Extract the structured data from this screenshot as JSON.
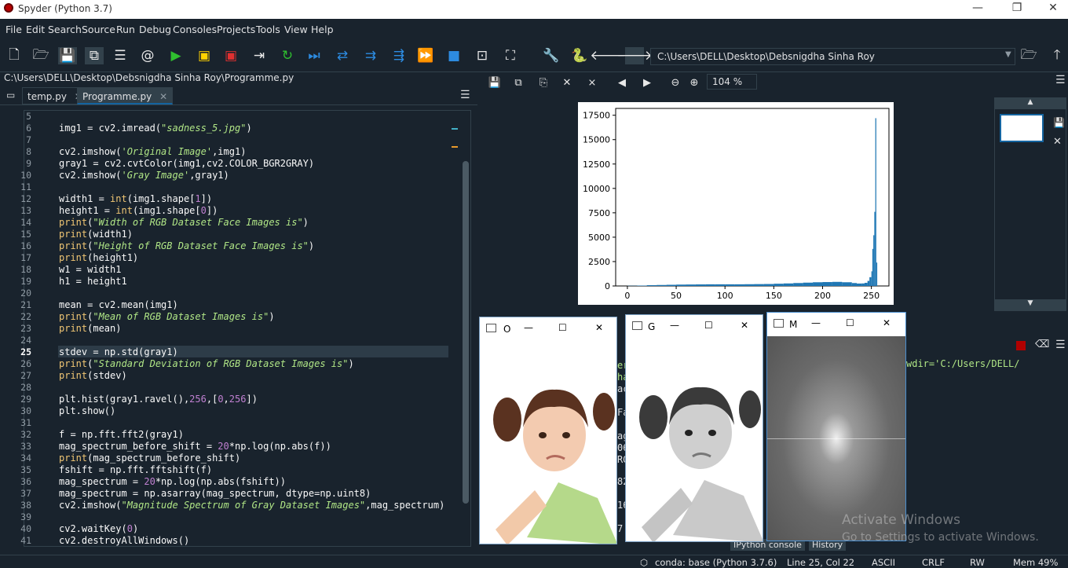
{
  "window": {
    "title": "Spyder (Python 3.7)",
    "minimize": "—",
    "restore": "❐",
    "close": "✕"
  },
  "menu": [
    "File",
    "Edit",
    "Search",
    "Source",
    "Run",
    "Debug",
    "Consoles",
    "Projects",
    "Tools",
    "View",
    "Help"
  ],
  "toolbar": {
    "working_dir": "C:\\Users\\DELL\\Desktop\\Debsnigdha Sinha Roy"
  },
  "editor": {
    "file_path": "C:\\Users\\DELL\\Desktop\\Debsnigdha Sinha Roy\\Programme.py",
    "tabs": [
      {
        "label": "temp.py",
        "active": false
      },
      {
        "label": "Programme.py",
        "active": true
      }
    ],
    "current_line": "25",
    "lines": [
      {
        "n": "5",
        "html": ""
      },
      {
        "n": "6",
        "html": "img1 = cv2.imread(<span class='str'>\"<i>sadness_5.jpg</i>\"</span>)"
      },
      {
        "n": "7",
        "html": ""
      },
      {
        "n": "8",
        "html": "cv2.imshow(<span class='str'><i>'Original Image'</i></span>,img1)"
      },
      {
        "n": "9",
        "html": "gray1 = cv2.cvtColor(img1,cv2.COLOR_BGR2GRAY)"
      },
      {
        "n": "10",
        "html": "cv2.imshow(<span class='str'><i>'Gray Image'</i></span>,gray1)"
      },
      {
        "n": "11",
        "html": ""
      },
      {
        "n": "12",
        "html": "width1 = <span class='kw'>int</span>(img1.shape[<span class='num'>1</span>])"
      },
      {
        "n": "13",
        "html": "height1 = <span class='kw'>int</span>(img1.shape[<span class='num'>0</span>])"
      },
      {
        "n": "14",
        "html": "<span class='kw'>print</span>(<span class='str'><i>\"Width of RGB Dataset Face Images is\"</i></span>)"
      },
      {
        "n": "15",
        "html": "<span class='kw'>print</span>(width1)"
      },
      {
        "n": "16",
        "html": "<span class='kw'>print</span>(<span class='str'><i>\"Height of RGB Dataset Face Images is\"</i></span>)"
      },
      {
        "n": "17",
        "html": "<span class='kw'>print</span>(height1)"
      },
      {
        "n": "18",
        "html": "w1 = width1"
      },
      {
        "n": "19",
        "html": "h1 = height1"
      },
      {
        "n": "20",
        "html": ""
      },
      {
        "n": "21",
        "html": "mean = cv2.mean(img1)"
      },
      {
        "n": "22",
        "html": "<span class='kw'>print</span>(<span class='str'><i>\"Mean of RGB Dataset Images is\"</i></span>)"
      },
      {
        "n": "23",
        "html": "<span class='kw'>print</span>(mean)"
      },
      {
        "n": "24",
        "html": ""
      },
      {
        "n": "25",
        "html": "stdev = np.std(gray1)"
      },
      {
        "n": "26",
        "html": "<span class='kw'>print</span>(<span class='str'><i>\"Standard Deviation of RGB Dataset Images is\"</i></span>)"
      },
      {
        "n": "27",
        "html": "<span class='kw'>print</span>(stdev)"
      },
      {
        "n": "28",
        "html": ""
      },
      {
        "n": "29",
        "html": "plt.hist(gray1.ravel(),<span class='num'>256</span>,[<span class='num'>0</span>,<span class='num'>256</span>])"
      },
      {
        "n": "30",
        "html": "plt.show()"
      },
      {
        "n": "31",
        "html": ""
      },
      {
        "n": "32",
        "html": "f = np.fft.fft2(gray1)"
      },
      {
        "n": "33",
        "html": "mag_spectrum_before_shift = <span class='num'>20</span>*np.log(np.abs(f))"
      },
      {
        "n": "34",
        "html": "<span class='kw'>print</span>(mag_spectrum_before_shift)"
      },
      {
        "n": "35",
        "html": "fshift = np.fft.fftshift(f)"
      },
      {
        "n": "36",
        "html": "mag_spectrum = <span class='num'>20</span>*np.log(np.abs(fshift))"
      },
      {
        "n": "37",
        "html": "mag_spectrum = np.asarray(mag_spectrum, dtype=np.uint8)"
      },
      {
        "n": "38",
        "html": "cv2.imshow(<span class='str'><i>\"Magnitude Spectrum of Gray Dataset Images\"</i></span>,mag_spectrum)"
      },
      {
        "n": "39",
        "html": ""
      },
      {
        "n": "40",
        "html": "cv2.waitKey(<span class='num'>0</span>)"
      },
      {
        "n": "41",
        "html": "cv2.destroyAllWindows()"
      }
    ]
  },
  "plots": {
    "zoom": "104 %"
  },
  "chart_data": {
    "type": "bar",
    "title": "",
    "xlabel": "",
    "ylabel": "",
    "xlim": [
      -12,
      268
    ],
    "ylim": [
      0,
      18200
    ],
    "xticks": [
      0,
      50,
      100,
      150,
      200,
      250
    ],
    "yticks": [
      0,
      2500,
      5000,
      7500,
      10000,
      12500,
      15000,
      17500
    ],
    "bins_x": [
      0,
      10,
      20,
      30,
      40,
      50,
      60,
      70,
      80,
      90,
      100,
      110,
      120,
      130,
      140,
      150,
      160,
      170,
      180,
      190,
      200,
      210,
      220,
      230,
      235,
      240,
      243,
      246,
      248,
      250,
      251,
      252,
      253,
      254,
      255
    ],
    "values": [
      20,
      40,
      80,
      100,
      120,
      140,
      150,
      160,
      170,
      170,
      170,
      170,
      180,
      190,
      200,
      230,
      260,
      300,
      340,
      380,
      400,
      420,
      380,
      300,
      250,
      260,
      320,
      520,
      900,
      1500,
      3800,
      5200,
      7600,
      17200,
      2400
    ],
    "grid": false,
    "color": "#1f77b4"
  },
  "cv_windows": [
    {
      "title": "O",
      "min": "—",
      "max": "☐",
      "close": "✕"
    },
    {
      "title": "G",
      "min": "—",
      "max": "☐",
      "close": "✕"
    },
    {
      "title": "M",
      "min": "—",
      "max": "☐",
      "close": "✕"
    }
  ],
  "console": {
    "fragments": [
      "er",
      "ha",
      "ac",
      "Fa",
      "ag",
      "06",
      "RG",
      "82",
      "16",
      "7",
      "wdir='C:/Users/DELL/"
    ],
    "tabs": [
      "IPython console",
      "History"
    ]
  },
  "watermark": {
    "title": "Activate Windows",
    "subtitle": "Go to Settings to activate Windows."
  },
  "status": {
    "env": "conda: base (Python 3.7.6)",
    "position": "Line 25, Col 22",
    "encoding": "ASCII",
    "eol": "CRLF",
    "perm": "RW",
    "mem": "Mem 49%"
  }
}
